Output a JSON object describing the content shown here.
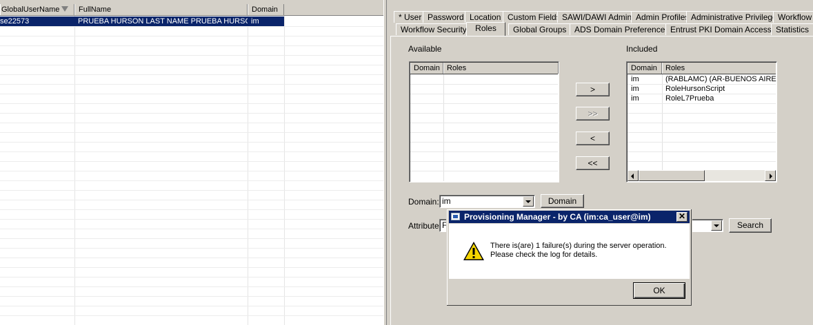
{
  "grid": {
    "columns": [
      "GlobalUserName",
      "FullName",
      "Domain"
    ],
    "rows": [
      {
        "global_user_name": "se22573",
        "full_name": "PRUEBA HURSON LAST NAME PRUEBA HURSON.",
        "domain": "im"
      }
    ]
  },
  "tabs": {
    "row1": [
      "* User",
      "Password",
      "Location",
      "Custom Fields",
      "SAWI/DAWI Admin",
      "Admin Profiles",
      "Administrative Privileges",
      "Workflow"
    ],
    "row2": [
      "Workflow Security",
      "Roles",
      "Global Groups",
      "ADS Domain Preference",
      "Entrust PKI Domain Access",
      "Statistics"
    ],
    "active": "Roles"
  },
  "roles": {
    "available_label": "Available",
    "included_label": "Included",
    "columns": [
      "Domain",
      "Roles"
    ],
    "available": [],
    "included": [
      {
        "domain": "im",
        "role": "(RABLAMC) (AR-BUENOS AIRES"
      },
      {
        "domain": "im",
        "role": "RoleHursonScript"
      },
      {
        "domain": "im",
        "role": "RoleL7Prueba"
      }
    ],
    "buttons": {
      "add": ">",
      "add_all": ">>",
      "remove": "<",
      "remove_all": "<<"
    }
  },
  "filter": {
    "domain_label": "Domain:",
    "domain_value": "im",
    "domain_button": "Domain",
    "attribute_label": "Attribute:",
    "attribute_value": "F",
    "search_button": "Search"
  },
  "dialog": {
    "title": "Provisioning Manager - by CA (im:ca_user@im)",
    "close": "✕",
    "message_line1": "There is(are) 1 failure(s) during the server operation.",
    "message_line2": "Please check the log for details.",
    "ok_label": "OK",
    "icon": "warning-icon"
  },
  "colors": {
    "selection": "#0a246a",
    "title_bar": "#0a246a",
    "face": "#d4d0c8"
  }
}
